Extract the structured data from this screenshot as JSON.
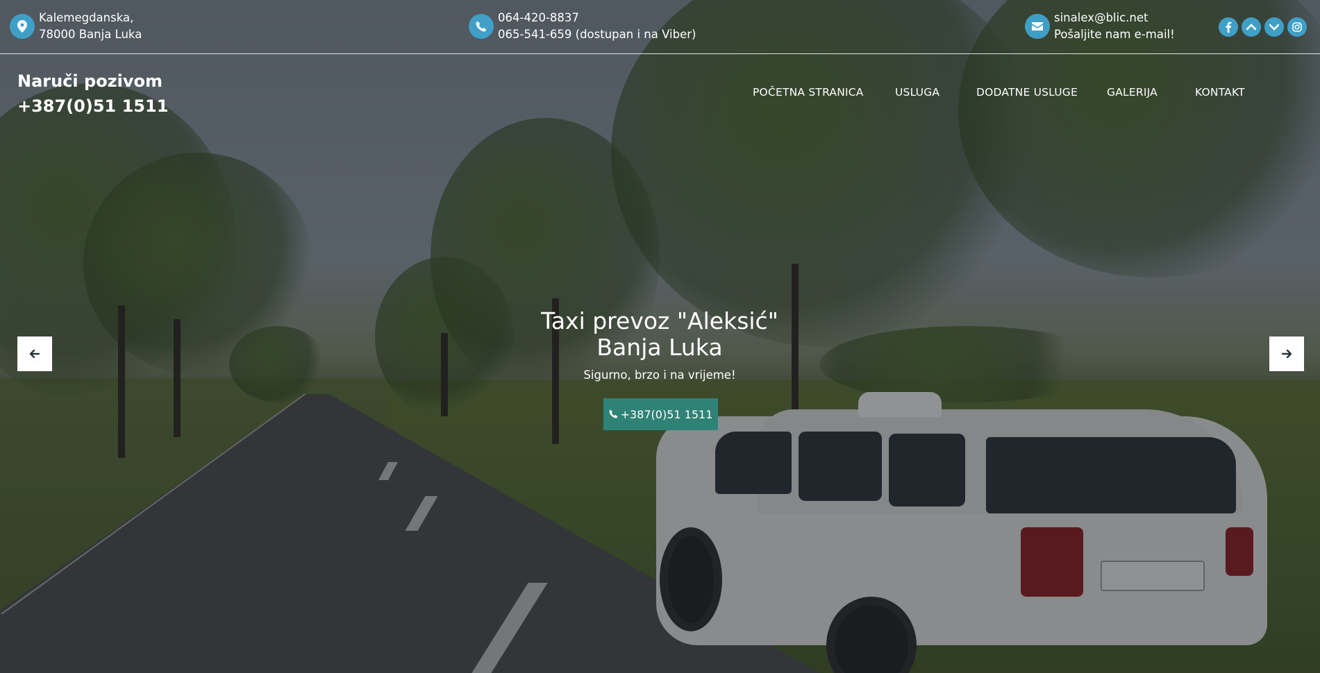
{
  "topbar": {
    "address": {
      "line1": "Kalemegdanska,",
      "line2": "78000 Banja Luka",
      "icon": "location-pin-icon"
    },
    "phone": {
      "line1": "064-420-8837",
      "line2": "065-541-659 (dostupan i na Viber)",
      "icon": "phone-icon"
    },
    "email": {
      "line1": "sinalex@blic.net",
      "line2": "Pošaljite nam e-mail!",
      "icon": "envelope-icon"
    },
    "social": [
      {
        "name": "facebook-icon",
        "glyph": "f"
      },
      {
        "name": "chevron-up-icon",
        "glyph": "⌃"
      },
      {
        "name": "chevron-down-icon",
        "glyph": "⌄"
      },
      {
        "name": "instagram-icon",
        "glyph": "◎"
      }
    ],
    "accent_color": "#3f9fc7"
  },
  "header": {
    "brand_line1": "Naruči pozivom",
    "brand_line2": "+387(0)51 1511"
  },
  "nav": {
    "items": [
      {
        "label": "POČETNA STRANICA"
      },
      {
        "label": "USLUGA"
      },
      {
        "label": "DODATNE USLUGE"
      },
      {
        "label": "GALERIJA"
      },
      {
        "label": "KONTAKT"
      }
    ]
  },
  "slider": {
    "title_line1": "Taxi prevoz \"Aleksić\"",
    "title_line2": "Banja Luka",
    "subtitle": "Sigurno, brzo i na vrijeme!",
    "cta_label": "+387(0)51 1511",
    "cta_color": "#2f8276",
    "prev_icon": "arrow-left-icon",
    "next_icon": "arrow-right-icon"
  }
}
